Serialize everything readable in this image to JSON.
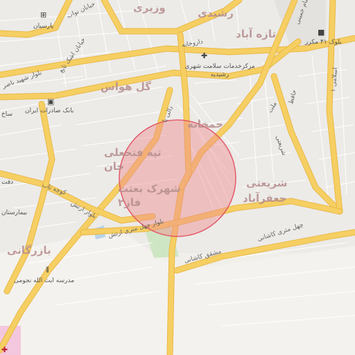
{
  "map": {
    "districts": {
      "vaziri": "وزیری",
      "rashidi": "رشیدی",
      "taze_abad": "تازه آباد",
      "gol_havas": "گل هواس",
      "jamkhaneh": "جمخانه",
      "tappe_fathali_khan": "تپه فتحعلی خان",
      "shahrak_besat_faz2": "شهرک بعثت فاز۲",
      "shariati": "شریعتی",
      "jafar_abad": "جعفرآباد",
      "bazargani": "بازرگانی"
    },
    "streets": {
      "navab": "خیابان نواب",
      "shahid_naser": "بلوار شهید ناصر",
      "ashk_tabi": "خیابان اشک تابع",
      "kuche_tab": "کوچه تاب",
      "artesh_blvd": "بلوار ارتش",
      "chehel_metri_artesh": "بلوار چهل متری ارتش",
      "chehel_metri_kashani": "چهل متری کاشانی",
      "mashgh_kashani": "مشقق کاشانی",
      "darvazeh": "داروخانه",
      "imam_khomeini": "امام خمینی",
      "mellat": "ملت",
      "shariati_st": "شریعتی",
      "hafez": "حافظ",
      "islami_1": "اسلامی ۱",
      "dalli_pa": "دالی پا"
    },
    "pois": {
      "health_center": "مرکزخدمات سلامت شهری رشیدیه",
      "bank_saderat": "بانک صادرات ایران",
      "parsian": "پارسیان",
      "block_41": "بلوک ۴۱ مکرر",
      "madrese": "مدرسه ایت الله نجومی",
      "hospital": "بیمارستان",
      "saakhteman": "ساخ",
      "dafter": "دفت"
    },
    "colors": {
      "background": "#f1efea",
      "major_road": "#f6cf63",
      "circle_fill": "#f08a8f",
      "circle_stroke": "#e25b6a",
      "park": "#cfe6c4",
      "water": "#b7d4ea",
      "hospital": "#f3c7dd"
    }
  }
}
